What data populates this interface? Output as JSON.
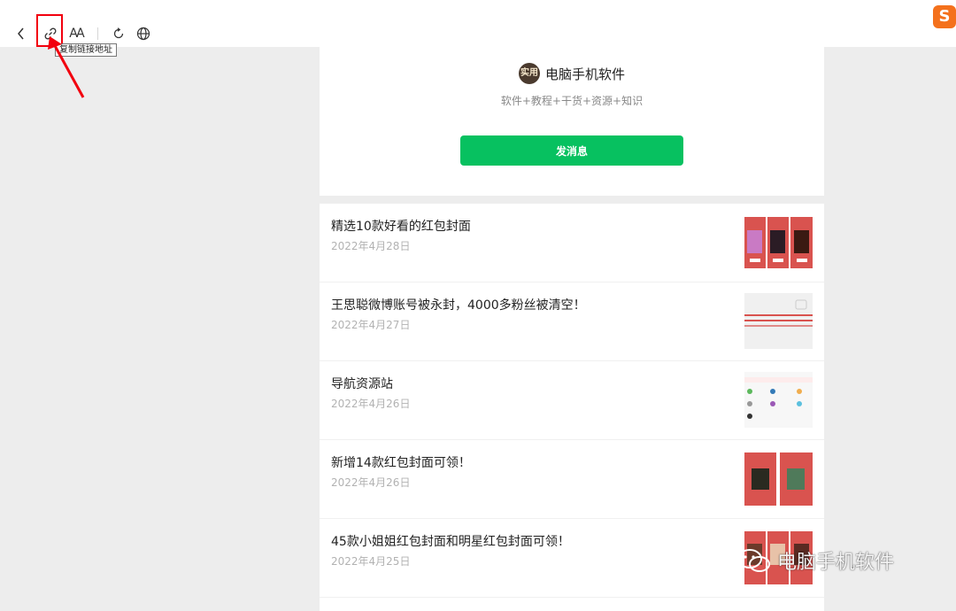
{
  "toolbar": {
    "tooltip": "复制链接地址",
    "font_icon_text": "AA",
    "icons": [
      "back-icon",
      "link-icon",
      "font-size-icon",
      "refresh-icon",
      "globe-icon"
    ],
    "sogou_logo_text": "S",
    "highlight_color": "#f2000e"
  },
  "profile": {
    "name": "电脑手机软件",
    "avatar_text": "实用",
    "description": "软件+教程+干货+资源+知识",
    "send_label": "发消息",
    "accent_color": "#07c160"
  },
  "articles": [
    {
      "title": "精选10款好看的红包封面",
      "date": "2022年4月28日"
    },
    {
      "title": "王思聪微博账号被永封，4000多粉丝被清空！",
      "date": "2022年4月27日"
    },
    {
      "title": "导航资源站",
      "date": "2022年4月26日"
    },
    {
      "title": "新增14款红包封面可领！",
      "date": "2022年4月26日"
    },
    {
      "title": "45款小姐姐红包封面和明星红包封面可领！",
      "date": "2022年4月25日"
    }
  ],
  "watermark": {
    "text": "电脑手机软件"
  }
}
